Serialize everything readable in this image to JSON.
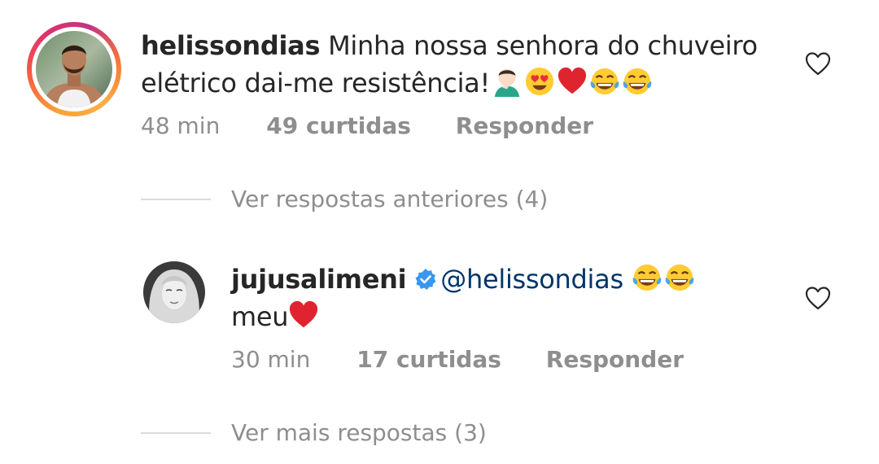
{
  "comments": [
    {
      "username": "helissondias",
      "text": "Minha nossa senhora do chuveiro elétrico dai-me resistência!",
      "emojis": [
        "man-facepalming-emoji",
        "heart-eyes-emoji",
        "red-heart-emoji",
        "tears-of-joy-emoji",
        "tears-of-joy-emoji"
      ],
      "time": "48 min",
      "likes": "49 curtidas",
      "reply_label": "Responder"
    }
  ],
  "replies_link_previous": "Ver respostas anteriores (4)",
  "reply": {
    "username": "jujusalimeni",
    "verified": true,
    "mention": "@helissondias",
    "text": "meu",
    "time": "30 min",
    "likes": "17 curtidas",
    "reply_label": "Responder"
  },
  "replies_link_more": "Ver mais respostas (3)",
  "colors": {
    "text": "#262626",
    "secondary": "#8e8e8e",
    "mention": "#003569",
    "verified": "#3897f0",
    "heart": "#e0242f",
    "divider": "#dbdbdb"
  }
}
